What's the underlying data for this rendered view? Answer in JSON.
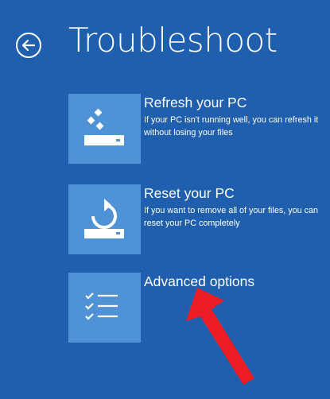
{
  "header": {
    "title": "Troubleshoot",
    "back_icon": "back-arrow-circle-icon"
  },
  "options": [
    {
      "id": "refresh",
      "title": "Refresh your PC",
      "description": "If your PC isn't running well, you can refresh it without losing your files",
      "icon": "refresh-pc-icon"
    },
    {
      "id": "reset",
      "title": "Reset your PC",
      "description": "If you want to remove all of your files, you can reset your PC completely",
      "icon": "reset-pc-icon"
    },
    {
      "id": "advanced",
      "title": "Advanced options",
      "description": "",
      "icon": "checklist-icon"
    }
  ],
  "colors": {
    "background": "#1f5fae",
    "tile": "#4f93d6",
    "text": "#ffffff",
    "annotation_arrow": "#ee1c25"
  }
}
